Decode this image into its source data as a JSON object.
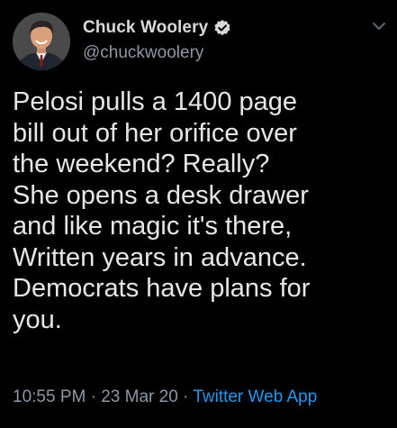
{
  "author": {
    "display_name": "Chuck Woolery",
    "handle": "@chuckwoolery",
    "verified": true
  },
  "tweet": {
    "lines": [
      "Pelosi pulls a 1400 page",
      "bill out of her orifice over",
      "the weekend? Really?",
      "She opens a desk drawer",
      "and like magic it's there,",
      "Written years in advance.",
      "Democrats have plans for",
      "you."
    ]
  },
  "meta": {
    "time": "10:55 PM",
    "separator1": " · ",
    "date": "23 Mar 20",
    "separator2": " · ",
    "source": "Twitter Web App"
  },
  "icons": {
    "verified": "verified-badge-icon",
    "menu": "chevron-down-icon"
  },
  "colors": {
    "background": "#000000",
    "link": "#1d9bf0",
    "secondary_text": "#8b98a5"
  }
}
